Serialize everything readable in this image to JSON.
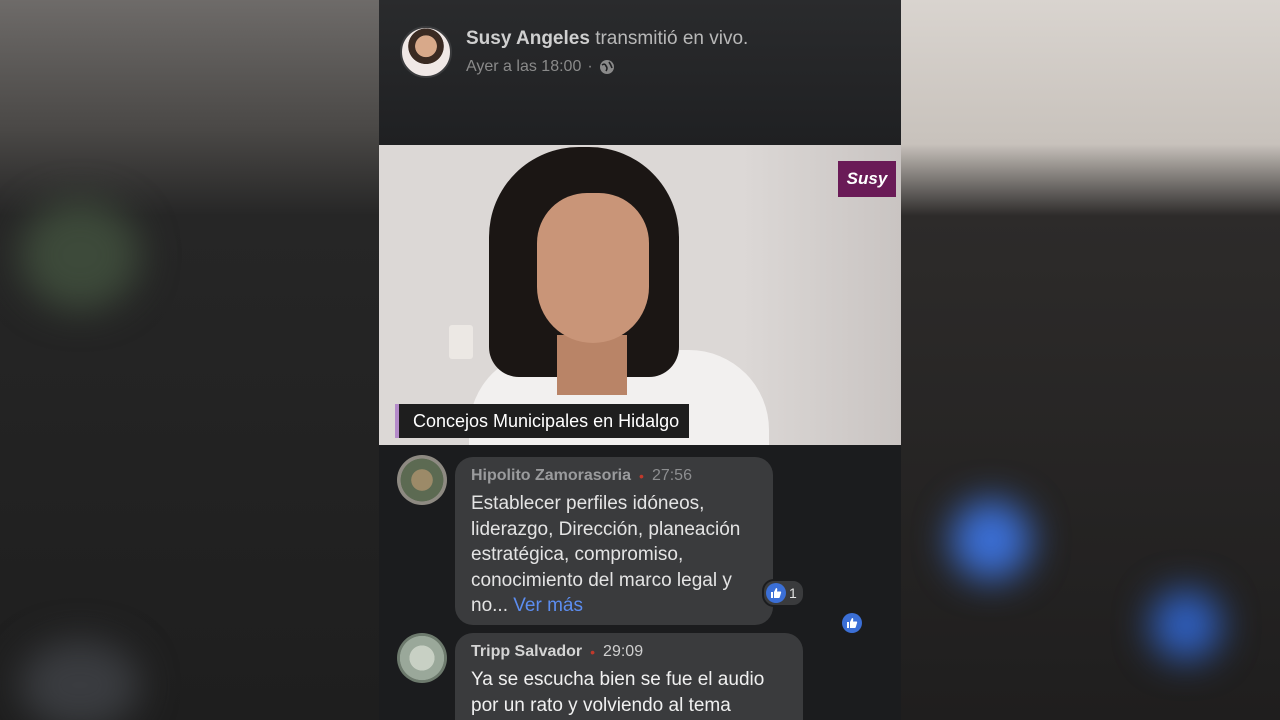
{
  "post": {
    "author": "Susy Angeles",
    "action": "transmitió en vivo.",
    "timestamp": "Ayer a las 18:00",
    "separator": "·"
  },
  "video": {
    "logo_text": "Susy",
    "caption": "Concejos Municipales en Hidalgo",
    "accent_color": "#b48ac9"
  },
  "comments": [
    {
      "author": "Hipolito Zamorasoria",
      "time": "27:56",
      "lines": [
        "Establecer perfiles idóneos,",
        "liderazgo, Dirección, planeación",
        "estratégica, compromiso,",
        "conocimiento del marco legal y"
      ],
      "last_line": "no...",
      "see_more": "Ver más",
      "reaction_count": "1"
    },
    {
      "author": "Tripp Salvador",
      "time": "29:09",
      "lines": [
        "Ya se escucha bien se fue el audio",
        "por un rato y volviendo al tema"
      ]
    }
  ],
  "colors": {
    "like_blue": "#3b6fd6",
    "link": "#5c8df0",
    "live_dot": "#c0392b"
  }
}
